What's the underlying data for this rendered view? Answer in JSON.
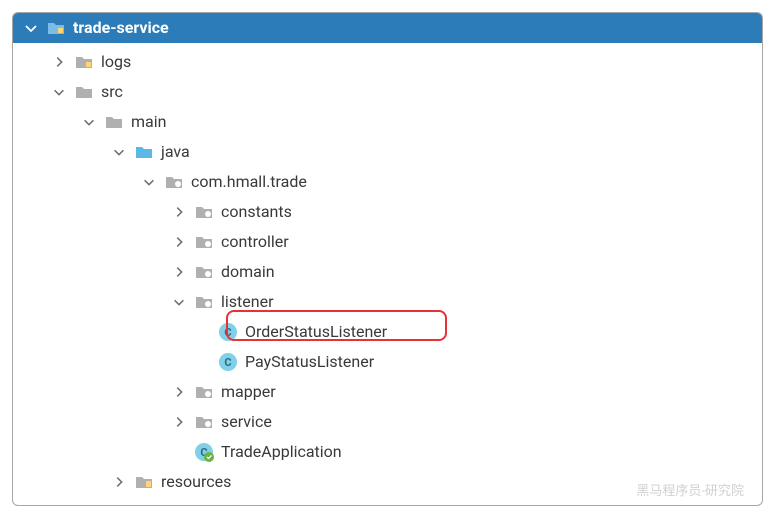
{
  "header": {
    "title": "trade-service"
  },
  "nodes": {
    "logs": "logs",
    "src": "src",
    "main": "main",
    "java": "java",
    "pkg": "com.hmall.trade",
    "constants": "constants",
    "controller": "controller",
    "domain": "domain",
    "listener": "listener",
    "orderStatusListener": "OrderStatusListener",
    "payStatusListener": "PayStatusListener",
    "mapper": "mapper",
    "service": "service",
    "tradeApplication": "TradeApplication",
    "resources": "resources"
  },
  "watermark": "黑马程序员-研究院"
}
